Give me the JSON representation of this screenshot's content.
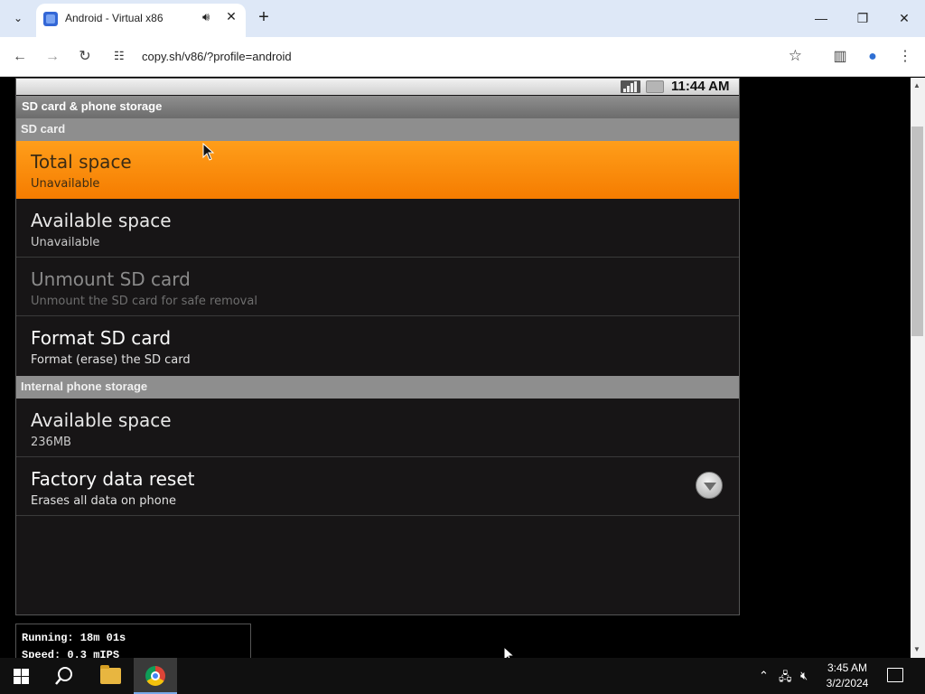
{
  "browser": {
    "tab_title": "Android - Virtual x86",
    "url": "copy.sh/v86/?profile=android",
    "icons": {
      "tab_search": "chevron-down-icon",
      "audio": "speaker-icon",
      "close": "close-icon",
      "new_tab": "plus-icon",
      "back": "back-arrow-icon",
      "forward": "forward-arrow-icon",
      "reload": "reload-icon",
      "site_info": "tune-icon",
      "bookmark": "star-icon",
      "side_panel": "side-panel-icon",
      "profile": "profile-icon",
      "menu": "kebab-menu-icon"
    }
  },
  "android": {
    "status_bar": {
      "time": "11:44 AM"
    },
    "screen_title": "SD card & phone storage",
    "sections": [
      {
        "label": "SD card"
      },
      {
        "label": "Internal phone storage"
      }
    ],
    "sd_items": [
      {
        "title": "Total space",
        "summary": "Unavailable"
      },
      {
        "title": "Available space",
        "summary": "Unavailable"
      },
      {
        "title": "Unmount SD card",
        "summary": "Unmount the SD card for safe removal"
      },
      {
        "title": "Format SD card",
        "summary": "Format (erase) the SD card"
      }
    ],
    "internal_items": [
      {
        "title": "Available space",
        "summary": "236MB"
      },
      {
        "title": "Factory data reset",
        "summary": "Erases all data on phone"
      }
    ],
    "accent_color": "#f57c00"
  },
  "v86_info": {
    "running": "Running: 18m 01s",
    "speed": "Speed: 0.3 mIPS"
  },
  "taskbar": {
    "time": "3:45 AM",
    "date": "3/2/2024"
  }
}
